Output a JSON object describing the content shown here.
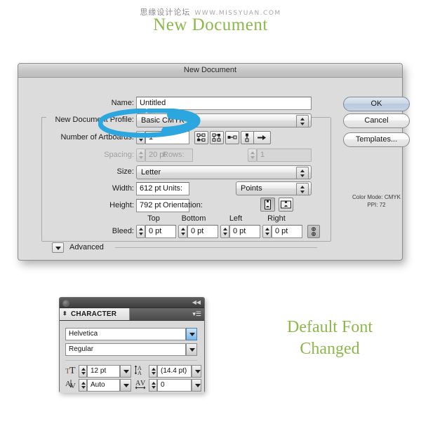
{
  "watermark": {
    "cn_text": "思缘设计论坛",
    "site": "WWW.MISSYUAN.COM"
  },
  "page_title": "New Document",
  "dialog": {
    "titlebar": "New Document",
    "fields": {
      "name_label": "Name:",
      "name_value": "Untitled",
      "profile_label": "New Document Profile:",
      "profile_value": "Basic CMYK",
      "artboards_label": "Number of Artboards:",
      "artboards_value": "1",
      "spacing_label": "Spacing:",
      "spacing_value": "20 pt",
      "rows_label": "Rows:",
      "rows_value": "1",
      "size_label": "Size:",
      "size_value": "Letter",
      "width_label": "Width:",
      "width_value": "612 pt",
      "units_label": "Units:",
      "units_value": "Points",
      "height_label": "Height:",
      "height_value": "792 pt",
      "orientation_label": "Orientation:",
      "bleed_label": "Bleed:",
      "bleed_top_header": "Top",
      "bleed_bottom_header": "Bottom",
      "bleed_left_header": "Left",
      "bleed_right_header": "Right",
      "bleed_top_value": "0 pt",
      "bleed_bottom_value": "0 pt",
      "bleed_left_value": "0 pt",
      "bleed_right_value": "0 pt",
      "advanced_label": "Advanced"
    },
    "buttons": {
      "ok": "OK",
      "cancel": "Cancel",
      "templates": "Templates..."
    },
    "info": {
      "color_mode": "Color Mode: CMYK",
      "ppi": "PPI: 72"
    },
    "icons": {
      "artboard_grid_by_row": "grid-by-row-icon",
      "artboard_grid_by_column": "grid-by-column-icon",
      "artboard_arrange_by_row": "arrange-by-row-icon",
      "artboard_arrange_by_column": "arrange-by-column-icon",
      "artboard_order_arrow": "right-to-left-order-icon",
      "orientation_portrait": "portrait-icon",
      "orientation_landscape": "landscape-icon",
      "bleed_link": "link-chain-icon"
    }
  },
  "annotation": {
    "type": "hand-drawn-ellipse",
    "color": "#2BA6DE",
    "target": "number-of-artboards-field"
  },
  "character_panel": {
    "tab_label": "CHARACTER",
    "font_family": "Helvetica",
    "font_style": "Regular",
    "font_size": "12 pt",
    "leading": "(14.4 pt)",
    "kerning": "Auto",
    "tracking": "0",
    "icons": {
      "font_size": "font-size-icon",
      "leading": "leading-icon",
      "kerning": "kerning-icon",
      "tracking": "tracking-icon",
      "panel_menu": "panel-menu-icon",
      "collapse": "collapse-icon"
    }
  },
  "green_note": {
    "line1": "Default Font",
    "line2": "Changed"
  }
}
